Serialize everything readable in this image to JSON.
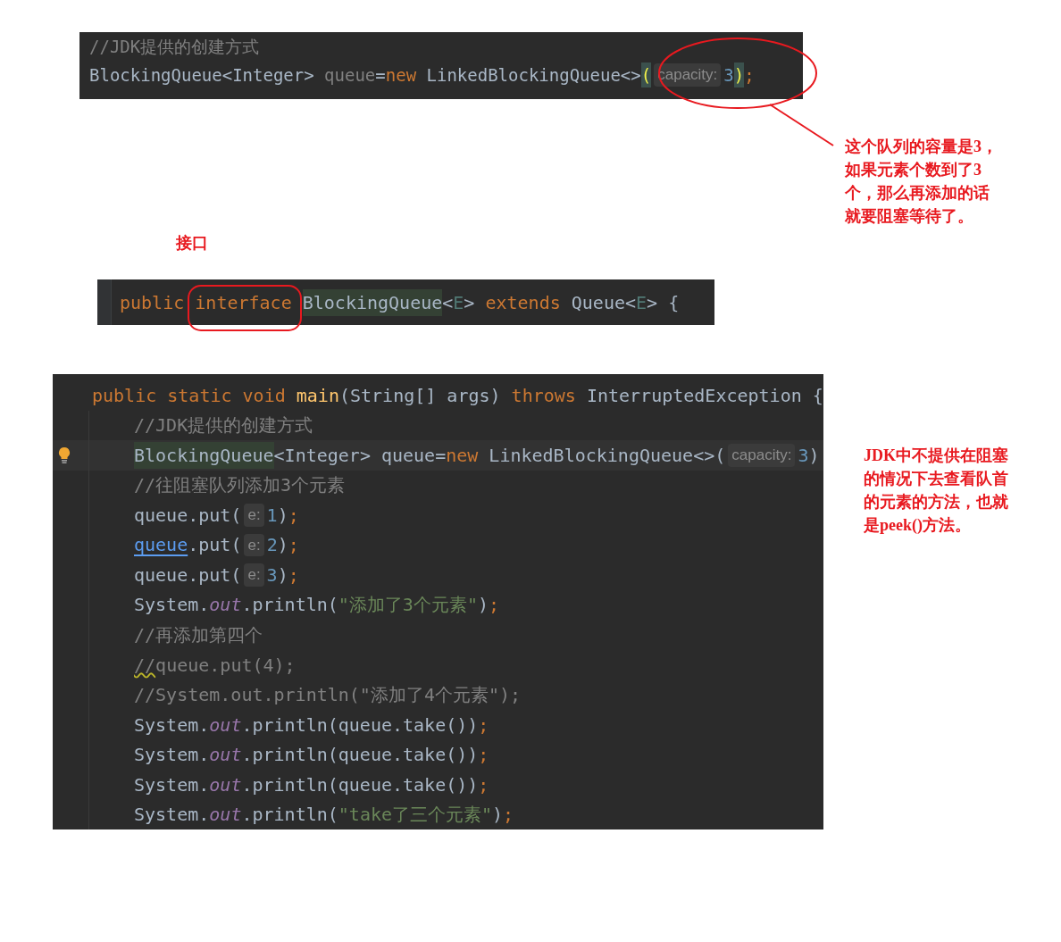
{
  "creation_snippet": {
    "lines": [
      {
        "tokens": [
          {
            "t": "//JDK提供的创建方式",
            "kind": "comment"
          }
        ]
      },
      {
        "tokens": [
          {
            "t": "BlockingQueue<Integer> ",
            "kind": "plain"
          },
          {
            "t": "queue",
            "kind": "unused"
          },
          {
            "t": "=",
            "kind": "plain"
          },
          {
            "t": "new",
            "kind": "kw"
          },
          {
            "t": " LinkedBlockingQueue<>",
            "kind": "plain"
          },
          {
            "t": "(",
            "kind": "bracket"
          },
          {
            "t": "capacity:",
            "kind": "hint"
          },
          {
            "t": "3",
            "kind": "num"
          },
          {
            "t": ")",
            "kind": "bracket"
          },
          {
            "t": ";",
            "kind": "semi"
          }
        ]
      }
    ]
  },
  "annotation_capacity": [
    "这个队列的容量是3，",
    "如果元素个数到了3",
    "个，那么再添加的话",
    "就要阻塞等待了。"
  ],
  "label_interface": "接口",
  "interface_snippet": {
    "lines": [
      {
        "tokens": [
          {
            "t": "public ",
            "kind": "kw"
          },
          {
            "t": "interface ",
            "kind": "kw"
          },
          {
            "t": "BlockingQueue",
            "kind": "usage"
          },
          {
            "t": "<",
            "kind": "plain"
          },
          {
            "t": "E",
            "kind": "generic"
          },
          {
            "t": "> ",
            "kind": "plain"
          },
          {
            "t": "extends",
            "kind": "kw"
          },
          {
            "t": " Queue<",
            "kind": "plain"
          },
          {
            "t": "E",
            "kind": "generic"
          },
          {
            "t": "> {",
            "kind": "plain"
          }
        ]
      }
    ]
  },
  "main_snippet": {
    "lines": [
      {
        "current": false,
        "tokens": [
          {
            "t": "public static void ",
            "kind": "kw"
          },
          {
            "t": "main",
            "kind": "method"
          },
          {
            "t": "(String[] args) ",
            "kind": "plain"
          },
          {
            "t": "throws",
            "kind": "kw"
          },
          {
            "t": " InterruptedException {",
            "kind": "plain"
          }
        ],
        "children": [
          {
            "current": false,
            "tokens": [
              {
                "t": "//JDK提供的创建方式",
                "kind": "comment"
              }
            ]
          },
          {
            "current": true,
            "tokens": [
              {
                "t": "BlockingQueue",
                "kind": "usage"
              },
              {
                "t": "<Integer> queue=",
                "kind": "plain"
              },
              {
                "t": "new",
                "kind": "kw"
              },
              {
                "t": " LinkedBlockingQueue<>(",
                "kind": "plain"
              },
              {
                "t": "capacity:",
                "kind": "hint"
              },
              {
                "t": "3",
                "kind": "num"
              },
              {
                "t": ")",
                "kind": "plain"
              }
            ]
          },
          {
            "current": false,
            "tokens": [
              {
                "t": "//往阻塞队列添加3个元素",
                "kind": "comment"
              }
            ]
          },
          {
            "current": false,
            "tokens": [
              {
                "t": "queue.put(",
                "kind": "plain"
              },
              {
                "t": "e:",
                "kind": "hint"
              },
              {
                "t": "1",
                "kind": "num"
              },
              {
                "t": ")",
                "kind": "plain"
              },
              {
                "t": ";",
                "kind": "semi"
              }
            ]
          },
          {
            "current": false,
            "tokens": [
              {
                "t": "queue",
                "kind": "link"
              },
              {
                "t": ".put(",
                "kind": "plain"
              },
              {
                "t": "e:",
                "kind": "hint"
              },
              {
                "t": "2",
                "kind": "num"
              },
              {
                "t": ")",
                "kind": "plain"
              },
              {
                "t": ";",
                "kind": "semi"
              }
            ]
          },
          {
            "current": false,
            "tokens": [
              {
                "t": "queue.put(",
                "kind": "plain"
              },
              {
                "t": "e:",
                "kind": "hint"
              },
              {
                "t": "3",
                "kind": "num"
              },
              {
                "t": ")",
                "kind": "plain"
              },
              {
                "t": ";",
                "kind": "semi"
              }
            ]
          },
          {
            "current": false,
            "tokens": [
              {
                "t": "System.",
                "kind": "plain"
              },
              {
                "t": "out",
                "kind": "field"
              },
              {
                "t": ".println(",
                "kind": "plain"
              },
              {
                "t": "\"添加了3个元素\"",
                "kind": "str"
              },
              {
                "t": ")",
                "kind": "plain"
              },
              {
                "t": ";",
                "kind": "semi"
              }
            ]
          },
          {
            "current": false,
            "tokens": [
              {
                "t": "//再添加第四个",
                "kind": "comment"
              }
            ]
          },
          {
            "current": false,
            "tokens": [
              {
                "t": "//",
                "kind": "typo"
              },
              {
                "t": "queue.put(4);",
                "kind": "comment"
              }
            ]
          },
          {
            "current": false,
            "tokens": [
              {
                "t": "//System.out.println(\"添加了4个元素\");",
                "kind": "comment"
              }
            ]
          },
          {
            "current": false,
            "tokens": [
              {
                "t": "System.",
                "kind": "plain"
              },
              {
                "t": "out",
                "kind": "field"
              },
              {
                "t": ".println(queue.take())",
                "kind": "plain"
              },
              {
                "t": ";",
                "kind": "semi"
              }
            ]
          },
          {
            "current": false,
            "tokens": [
              {
                "t": "System.",
                "kind": "plain"
              },
              {
                "t": "out",
                "kind": "field"
              },
              {
                "t": ".println(queue.take())",
                "kind": "plain"
              },
              {
                "t": ";",
                "kind": "semi"
              }
            ]
          },
          {
            "current": false,
            "tokens": [
              {
                "t": "System.",
                "kind": "plain"
              },
              {
                "t": "out",
                "kind": "field"
              },
              {
                "t": ".println(queue.take())",
                "kind": "plain"
              },
              {
                "t": ";",
                "kind": "semi"
              }
            ]
          },
          {
            "current": false,
            "tokens": [
              {
                "t": "System.",
                "kind": "plain"
              },
              {
                "t": "out",
                "kind": "field"
              },
              {
                "t": ".println(",
                "kind": "plain"
              },
              {
                "t": "\"take了三个元素\"",
                "kind": "str"
              },
              {
                "t": ")",
                "kind": "plain"
              },
              {
                "t": ";",
                "kind": "semi"
              }
            ]
          }
        ]
      }
    ]
  },
  "annotation_peek": [
    "JDK中不提供在阻塞",
    "的情况下去查看队首",
    "的元素的方法，也就",
    "是peek()方法。"
  ]
}
